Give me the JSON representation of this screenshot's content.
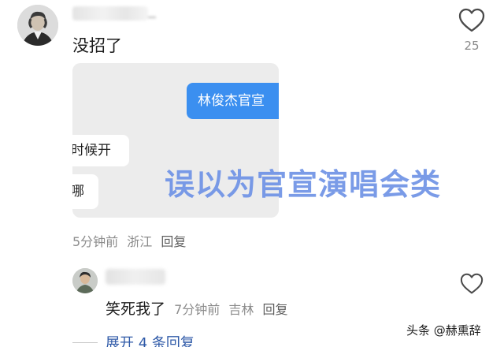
{
  "comment": {
    "text": "没招了",
    "like_count": "25",
    "meta": {
      "time": "5分钟前",
      "location": "浙江",
      "reply_label": "回复"
    },
    "embedded_image": {
      "bubble_right": "林俊杰官宣",
      "bubble_left_1": "时候开",
      "bubble_left_2": "哪",
      "overlay_caption": "误以为官宣演唱会类"
    }
  },
  "reply": {
    "text": "笑死我了",
    "time": "7分钟前",
    "location": "吉林",
    "reply_label": "回复"
  },
  "expand_label": "展开 4 条回复",
  "watermark": "头条 @赫熏辞",
  "icons": {
    "like": "heart-outline-icon"
  },
  "colors": {
    "bubble_blue": "#3b8ff0",
    "overlay_text": "#6f93e6",
    "expand_link": "#2f5aa8",
    "meta_gray": "#8c8c8c"
  }
}
